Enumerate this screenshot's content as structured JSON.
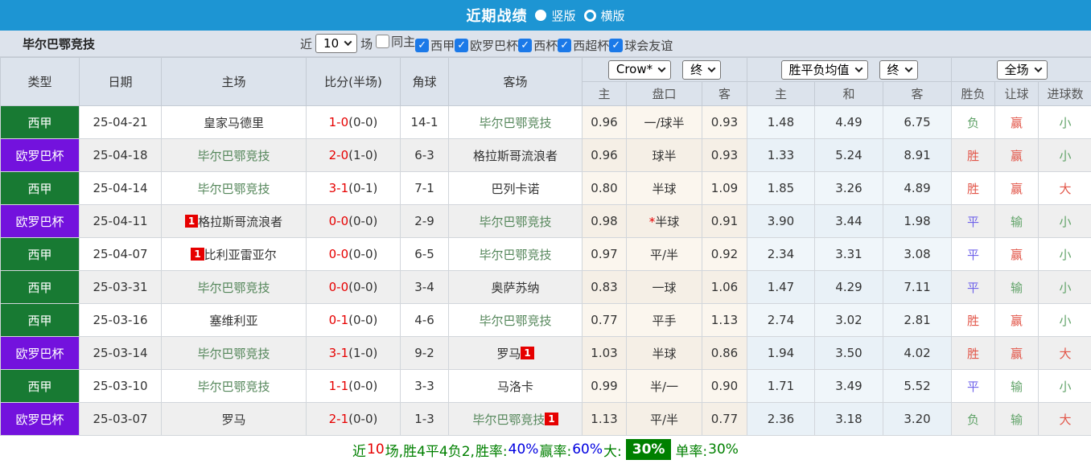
{
  "topbar": {
    "title": "近期战绩",
    "radios": [
      {
        "label": "竖版",
        "selected": true
      },
      {
        "label": "横版",
        "selected": false
      }
    ]
  },
  "filterbar": {
    "team": "毕尔巴鄂竞技",
    "near_label": "近",
    "count_select": "10",
    "count_suffix": "场",
    "checkboxes": [
      {
        "label": "同主",
        "checked": false
      },
      {
        "label": "西甲",
        "checked": true
      },
      {
        "label": "欧罗巴杯",
        "checked": true
      },
      {
        "label": "西杯",
        "checked": true
      },
      {
        "label": "西超杯",
        "checked": true
      },
      {
        "label": "球会友谊",
        "checked": true
      }
    ]
  },
  "table": {
    "static_headers": [
      "类型",
      "日期",
      "主场",
      "比分(半场)",
      "角球",
      "客场"
    ],
    "selects": {
      "odds_company": "Crow*",
      "odds_state": "终",
      "avg_label": "胜平负均值",
      "avg_state": "终",
      "scope": "全场"
    },
    "sub_headers": {
      "odds": [
        "主",
        "盘口",
        "客"
      ],
      "avg": [
        "主",
        "和",
        "客"
      ],
      "results": [
        "胜负",
        "让球",
        "进球数"
      ]
    },
    "rows": [
      {
        "type": "西甲",
        "type_color": "green",
        "date": "25-04-21",
        "home": {
          "name": "皇家马德里",
          "tracked": false,
          "badge": null
        },
        "score": "1-0",
        "half": "(0-0)",
        "corner": "14-1",
        "away": {
          "name": "毕尔巴鄂竞技",
          "tracked": true,
          "badge": null
        },
        "odds": [
          "0.96",
          "一/球半",
          "0.93"
        ],
        "avg": [
          "1.48",
          "4.49",
          "6.75"
        ],
        "results": [
          "负",
          "赢",
          "小"
        ]
      },
      {
        "type": "欧罗巴杯",
        "type_color": "purple",
        "date": "25-04-18",
        "home": {
          "name": "毕尔巴鄂竞技",
          "tracked": true,
          "badge": null
        },
        "score": "2-0",
        "half": "(1-0)",
        "corner": "6-3",
        "away": {
          "name": "格拉斯哥流浪者",
          "tracked": false,
          "badge": null
        },
        "odds": [
          "0.96",
          "球半",
          "0.93"
        ],
        "avg": [
          "1.33",
          "5.24",
          "8.91"
        ],
        "results": [
          "胜",
          "赢",
          "小"
        ]
      },
      {
        "type": "西甲",
        "type_color": "green",
        "date": "25-04-14",
        "home": {
          "name": "毕尔巴鄂竞技",
          "tracked": true,
          "badge": null
        },
        "score": "3-1",
        "half": "(0-1)",
        "corner": "7-1",
        "away": {
          "name": "巴列卡诺",
          "tracked": false,
          "badge": null
        },
        "odds": [
          "0.80",
          "半球",
          "1.09"
        ],
        "avg": [
          "1.85",
          "3.26",
          "4.89"
        ],
        "results": [
          "胜",
          "赢",
          "大"
        ]
      },
      {
        "type": "欧罗巴杯",
        "type_color": "purple",
        "date": "25-04-11",
        "home": {
          "name": "格拉斯哥流浪者",
          "tracked": false,
          "badge": "before"
        },
        "score": "0-0",
        "half": "(0-0)",
        "corner": "2-9",
        "away": {
          "name": "毕尔巴鄂竞技",
          "tracked": true,
          "badge": null
        },
        "odds": [
          "0.98",
          "*半球",
          "0.91"
        ],
        "avg": [
          "3.90",
          "3.44",
          "1.98"
        ],
        "results": [
          "平",
          "输",
          "小"
        ]
      },
      {
        "type": "西甲",
        "type_color": "green",
        "date": "25-04-07",
        "home": {
          "name": "比利亚雷亚尔",
          "tracked": false,
          "badge": "before"
        },
        "score": "0-0",
        "half": "(0-0)",
        "corner": "6-5",
        "away": {
          "name": "毕尔巴鄂竞技",
          "tracked": true,
          "badge": null
        },
        "odds": [
          "0.97",
          "平/半",
          "0.92"
        ],
        "avg": [
          "2.34",
          "3.31",
          "3.08"
        ],
        "results": [
          "平",
          "赢",
          "小"
        ]
      },
      {
        "type": "西甲",
        "type_color": "green",
        "date": "25-03-31",
        "home": {
          "name": "毕尔巴鄂竞技",
          "tracked": true,
          "badge": null
        },
        "score": "0-0",
        "half": "(0-0)",
        "corner": "3-4",
        "away": {
          "name": "奥萨苏纳",
          "tracked": false,
          "badge": null
        },
        "odds": [
          "0.83",
          "一球",
          "1.06"
        ],
        "avg": [
          "1.47",
          "4.29",
          "7.11"
        ],
        "results": [
          "平",
          "输",
          "小"
        ]
      },
      {
        "type": "西甲",
        "type_color": "green",
        "date": "25-03-16",
        "home": {
          "name": "塞维利亚",
          "tracked": false,
          "badge": null
        },
        "score": "0-1",
        "half": "(0-0)",
        "corner": "4-6",
        "away": {
          "name": "毕尔巴鄂竞技",
          "tracked": true,
          "badge": null
        },
        "odds": [
          "0.77",
          "平手",
          "1.13"
        ],
        "avg": [
          "2.74",
          "3.02",
          "2.81"
        ],
        "results": [
          "胜",
          "赢",
          "小"
        ]
      },
      {
        "type": "欧罗巴杯",
        "type_color": "purple",
        "date": "25-03-14",
        "home": {
          "name": "毕尔巴鄂竞技",
          "tracked": true,
          "badge": null
        },
        "score": "3-1",
        "half": "(1-0)",
        "corner": "9-2",
        "away": {
          "name": "罗马",
          "tracked": false,
          "badge": "after"
        },
        "odds": [
          "1.03",
          "半球",
          "0.86"
        ],
        "avg": [
          "1.94",
          "3.50",
          "4.02"
        ],
        "results": [
          "胜",
          "赢",
          "大"
        ]
      },
      {
        "type": "西甲",
        "type_color": "green",
        "date": "25-03-10",
        "home": {
          "name": "毕尔巴鄂竞技",
          "tracked": true,
          "badge": null
        },
        "score": "1-1",
        "half": "(0-0)",
        "corner": "3-3",
        "away": {
          "name": "马洛卡",
          "tracked": false,
          "badge": null
        },
        "odds": [
          "0.99",
          "半/一",
          "0.90"
        ],
        "avg": [
          "1.71",
          "3.49",
          "5.52"
        ],
        "results": [
          "平",
          "输",
          "小"
        ]
      },
      {
        "type": "欧罗巴杯",
        "type_color": "purple",
        "date": "25-03-07",
        "home": {
          "name": "罗马",
          "tracked": false,
          "badge": null
        },
        "score": "2-1",
        "half": "(0-0)",
        "corner": "1-3",
        "away": {
          "name": "毕尔巴鄂竞技",
          "tracked": true,
          "badge": "after"
        },
        "odds": [
          "1.13",
          "平/半",
          "0.77"
        ],
        "avg": [
          "2.36",
          "3.18",
          "3.20"
        ],
        "results": [
          "负",
          "输",
          "大"
        ]
      }
    ]
  },
  "footer": {
    "segments": [
      {
        "text": "近",
        "color": "green"
      },
      {
        "text": "10",
        "color": "red"
      },
      {
        "text": "场,胜4平4负2, ",
        "color": "green"
      },
      {
        "text": "胜率:",
        "color": "green"
      },
      {
        "text": "40%",
        "color": "blue"
      },
      {
        "text": " 赢率:",
        "color": "green"
      },
      {
        "text": "60%",
        "color": "blue"
      },
      {
        "text": " 大:",
        "color": "green"
      },
      {
        "text": "30%",
        "color": "badge"
      },
      {
        "text": " 单率:",
        "color": "green"
      },
      {
        "text": "30%",
        "color": "green"
      }
    ]
  },
  "colors": {
    "topbar_bg": "#1d95d3",
    "laliga_green": "#187a33",
    "europa_purple": "#7312dd",
    "score_red": "#e60000",
    "tracked_team_green": "#54865a",
    "win_red": "#e25548",
    "draw_blue": "#6f63ea",
    "lose_green": "#61a369",
    "footer_badge_green": "#008000"
  }
}
